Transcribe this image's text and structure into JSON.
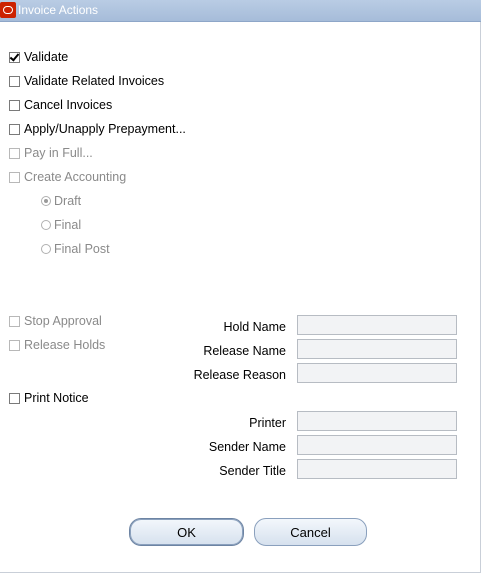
{
  "window": {
    "title": "Invoice Actions"
  },
  "actions": {
    "validate": {
      "label": "Validate",
      "checked": true,
      "enabled": true
    },
    "validate_related": {
      "label": "Validate Related Invoices",
      "checked": false,
      "enabled": true
    },
    "cancel_invoices": {
      "label": "Cancel Invoices",
      "checked": false,
      "enabled": true
    },
    "apply_unapply": {
      "label": "Apply/Unapply Prepayment...",
      "checked": false,
      "enabled": true
    },
    "pay_in_full": {
      "label": "Pay in Full...",
      "checked": false,
      "enabled": false
    },
    "create_accounting": {
      "label": "Create Accounting",
      "checked": false,
      "enabled": false
    }
  },
  "accounting_modes": [
    {
      "label": "Draft",
      "selected": true
    },
    {
      "label": "Final",
      "selected": false
    },
    {
      "label": "Final Post",
      "selected": false
    }
  ],
  "approval": {
    "stop_approval": {
      "label": "Stop Approval",
      "checked": false,
      "enabled": false
    },
    "release_holds": {
      "label": "Release Holds",
      "checked": false,
      "enabled": false
    },
    "hold_name_label": "Hold Name",
    "release_name_label": "Release Name",
    "release_reason_label": "Release Reason",
    "hold_name": "",
    "release_name": "",
    "release_reason": ""
  },
  "notice": {
    "print_notice": {
      "label": "Print Notice",
      "checked": false,
      "enabled": true
    },
    "printer_label": "Printer",
    "sender_name_label": "Sender Name",
    "sender_title_label": "Sender Title",
    "printer": "",
    "sender_name": "",
    "sender_title": ""
  },
  "buttons": {
    "ok": "OK",
    "cancel": "Cancel"
  },
  "colors": {
    "titlebar": "#a6bcd9",
    "logo": "#cc2200",
    "disabled_text": "#8a8a8a"
  }
}
